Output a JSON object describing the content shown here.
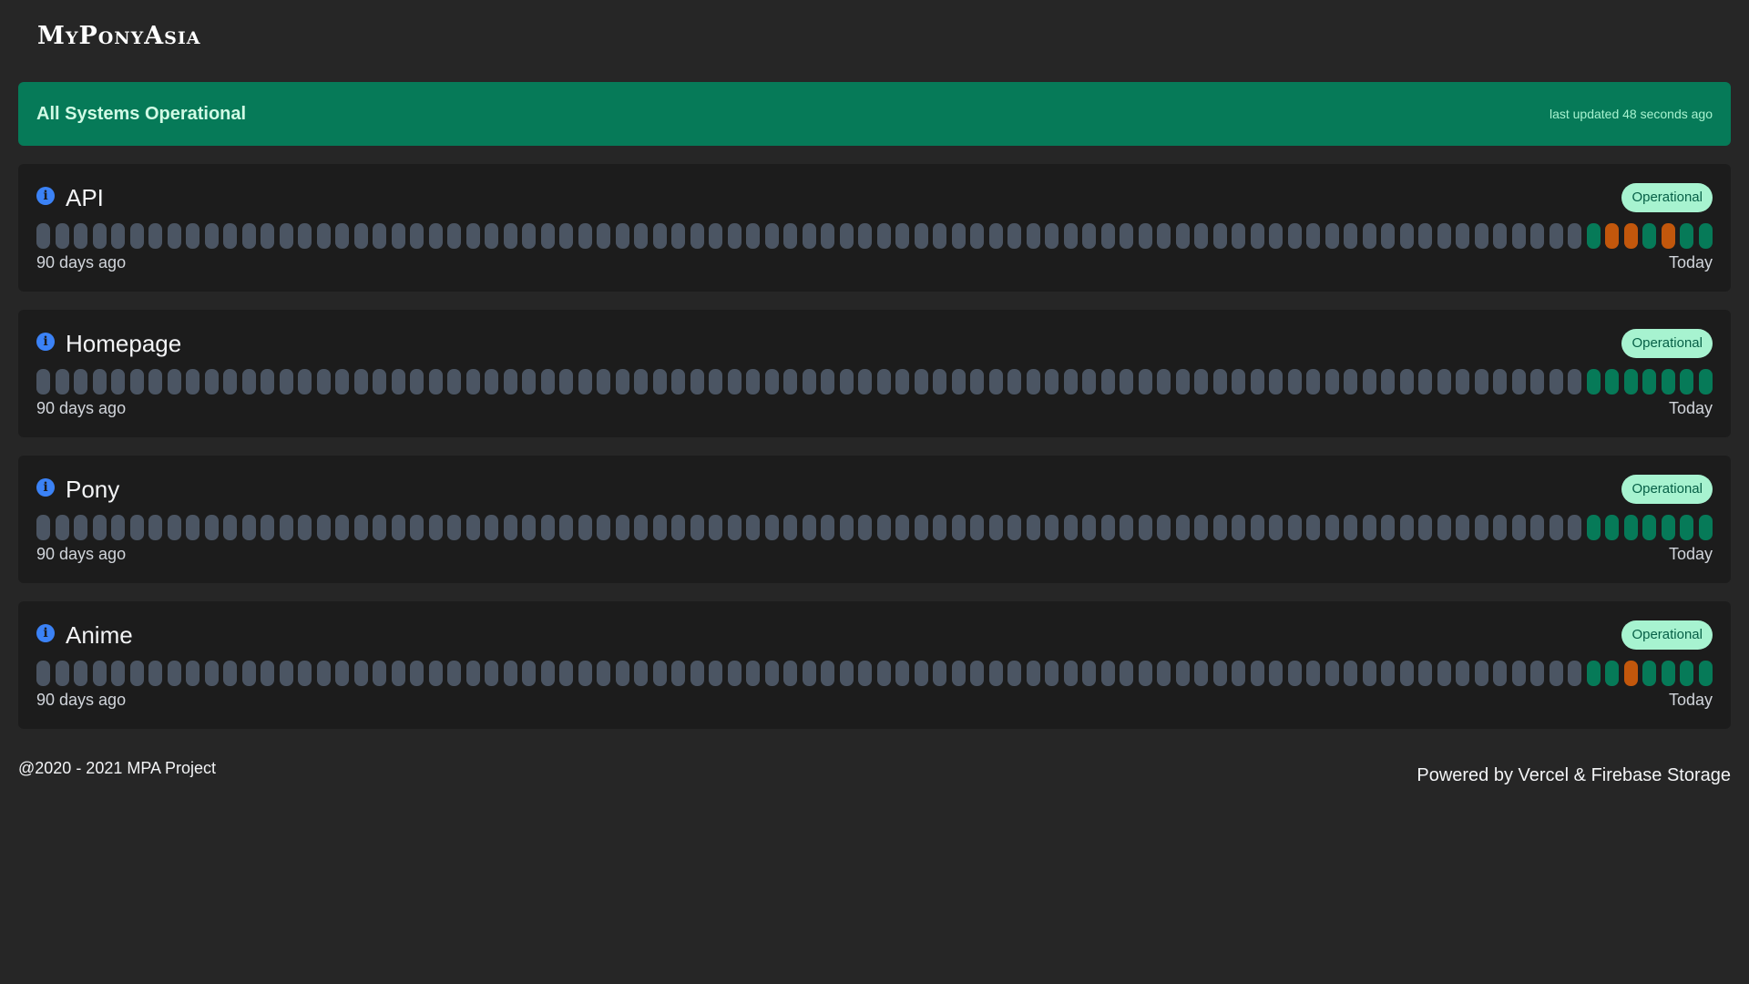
{
  "header": {
    "logo_text": "MyPonyAsia"
  },
  "banner": {
    "title": "All Systems Operational",
    "updated": "last updated 48 seconds ago"
  },
  "colors": {
    "no_data": "#4b5563",
    "operational": "#067a58",
    "degraded": "#c2570c",
    "banner": "#067a58",
    "badge_bg": "#a7f3d0",
    "info_icon": "#3b82f6"
  },
  "history_range": {
    "start_label": "90 days ago",
    "end_label": "Today"
  },
  "services": [
    {
      "name": "API",
      "status": "Operational",
      "recent": [
        "operational",
        "degraded",
        "degraded",
        "operational",
        "degraded",
        "operational",
        "operational"
      ]
    },
    {
      "name": "Homepage",
      "status": "Operational",
      "recent": [
        "operational",
        "operational",
        "operational",
        "operational",
        "operational",
        "operational",
        "operational"
      ]
    },
    {
      "name": "Pony",
      "status": "Operational",
      "recent": [
        "operational",
        "operational",
        "operational",
        "operational",
        "operational",
        "operational",
        "operational"
      ]
    },
    {
      "name": "Anime",
      "status": "Operational",
      "recent": [
        "operational",
        "operational",
        "degraded",
        "operational",
        "operational",
        "operational",
        "operational"
      ]
    }
  ],
  "bars_per_service": 90,
  "footer": {
    "copyright": "@2020 - 2021 MPA Project",
    "powered_by": "Powered by Vercel & Firebase Storage"
  }
}
